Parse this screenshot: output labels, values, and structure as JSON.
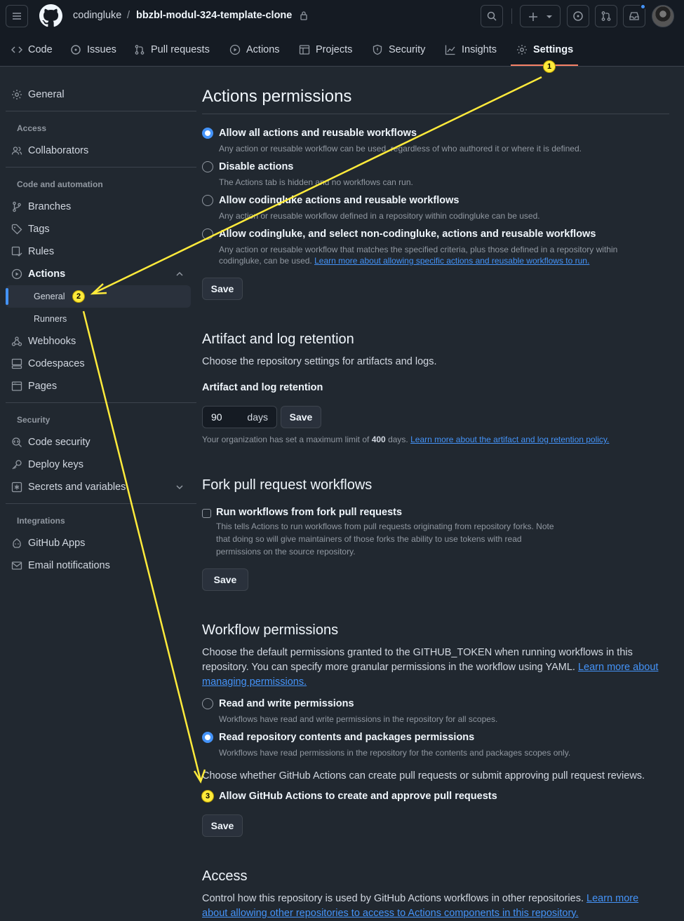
{
  "header": {
    "owner": "codingluke",
    "separator": "/",
    "repo": "bbzbl-modul-324-template-clone"
  },
  "repo_nav": {
    "tabs": [
      {
        "label": "Code"
      },
      {
        "label": "Issues"
      },
      {
        "label": "Pull requests"
      },
      {
        "label": "Actions"
      },
      {
        "label": "Projects"
      },
      {
        "label": "Security"
      },
      {
        "label": "Insights"
      },
      {
        "label": "Settings"
      }
    ]
  },
  "sidebar": {
    "general": "General",
    "access_heading": "Access",
    "collaborators": "Collaborators",
    "code_heading": "Code and automation",
    "branches": "Branches",
    "tags": "Tags",
    "rules": "Rules",
    "actions": "Actions",
    "actions_general": "General",
    "runners": "Runners",
    "webhooks": "Webhooks",
    "codespaces": "Codespaces",
    "pages": "Pages",
    "security_heading": "Security",
    "code_security": "Code security",
    "deploy_keys": "Deploy keys",
    "secrets": "Secrets and variables",
    "integrations_heading": "Integrations",
    "github_apps": "GitHub Apps",
    "email_notifications": "Email notifications"
  },
  "actions_permissions": {
    "title": "Actions permissions",
    "options": [
      {
        "label": "Allow all actions and reusable workflows",
        "desc": "Any action or reusable workflow can be used, regardless of who authored it or where it is defined.",
        "selected": true
      },
      {
        "label": "Disable actions",
        "desc": "The Actions tab is hidden and no workflows can run.",
        "selected": false
      },
      {
        "label": "Allow codingluke actions and reusable workflows",
        "desc": "Any action or reusable workflow defined in a repository within codingluke can be used.",
        "selected": false
      },
      {
        "label": "Allow codingluke, and select non-codingluke, actions and reusable workflows",
        "desc": "Any action or reusable workflow that matches the specified criteria, plus those defined in a repository within",
        "desc2": "codingluke, can be used.",
        "link": "Learn more about allowing specific actions and reusable workflows to run.",
        "selected": false
      }
    ],
    "save": "Save"
  },
  "artifact": {
    "title": "Artifact and log retention",
    "desc": "Choose the repository settings for artifacts and logs.",
    "label": "Artifact and log retention",
    "value": "90",
    "unit": "days",
    "save": "Save",
    "note_pre": "Your organization has set a maximum limit of",
    "note_limit": "400",
    "note_post": "days.",
    "note_link": "Learn more about the artifact and log retention policy."
  },
  "fork": {
    "title": "Fork pull request workflows",
    "label": "Run workflows from fork pull requests",
    "desc1": "This tells Actions to run workflows from pull requests originating from repository forks. Note",
    "desc2": "that doing so will give maintainers of those forks the ability to use tokens with read",
    "desc3": "permissions on the source repository.",
    "save": "Save"
  },
  "workflow_permissions": {
    "title": "Workflow permissions",
    "line1": "Choose the default permissions granted to the GITHUB_TOKEN when running workflows in this",
    "line2": "repository. You can specify more granular permissions in the workflow using YAML.",
    "link1": "Learn more about",
    "link2": "managing permissions.",
    "options": [
      {
        "label": "Read and write permissions",
        "desc": "Workflows have read and write permissions in the repository for all scopes.",
        "selected": false
      },
      {
        "label": "Read repository contents and packages permissions",
        "desc": "Workflows have read permissions in the repository for the contents and packages scopes only.",
        "selected": true
      }
    ],
    "pr_text": "Choose whether GitHub Actions can create pull requests or submit approving pull request reviews.",
    "pr_checkbox": "Allow GitHub Actions to create and approve pull requests",
    "save": "Save"
  },
  "access": {
    "title": "Access",
    "line1": "Control how this repository is used by GitHub Actions workflows in other repositories.",
    "link1": "Learn more",
    "link2": "about allowing other repositories to access to Actions components in this repository."
  },
  "annotations": {
    "badge1": "1",
    "badge2": "2",
    "badge3": "3",
    "color": "#ffeb3b"
  },
  "colors": {
    "accent": "#4493f8",
    "underline": "#f78166",
    "background": "#212830"
  },
  "icons": [
    "hamburger-icon",
    "github-logo-icon",
    "lock-icon",
    "search-icon",
    "plus-icon",
    "issue-icon",
    "pull-request-icon",
    "inbox-icon",
    "gear-icon",
    "people-icon",
    "branch-icon",
    "tag-icon",
    "rules-icon",
    "play-icon",
    "webhook-icon",
    "codespaces-icon",
    "browser-icon",
    "shield-icon",
    "key-icon",
    "asterisk-icon",
    "apps-icon",
    "mail-icon"
  ]
}
